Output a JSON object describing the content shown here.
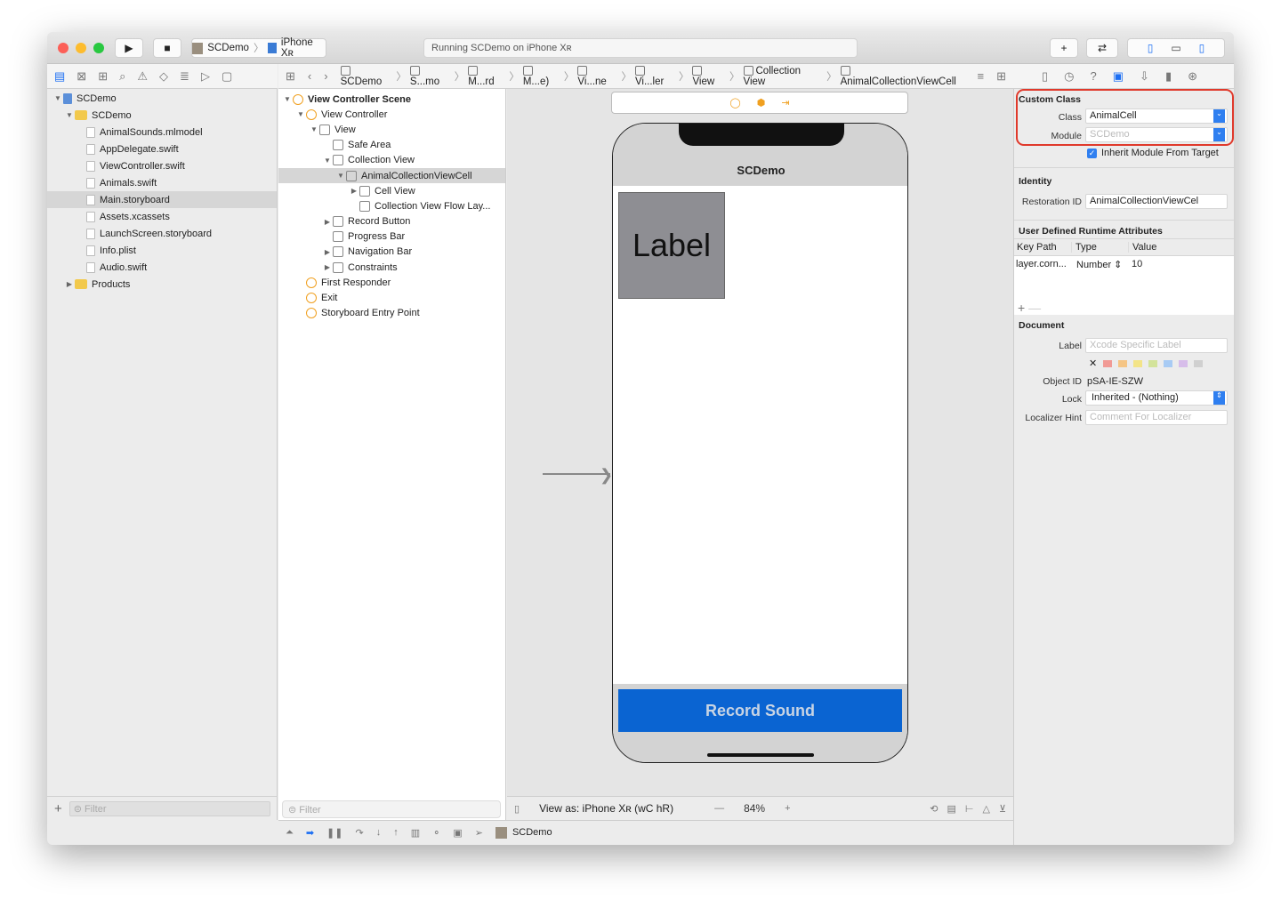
{
  "toolbar": {
    "scheme": "SCDemo",
    "device": "iPhone Xʀ",
    "status": "Running SCDemo on iPhone Xʀ"
  },
  "breadcrumb": [
    "SCDemo",
    "S...mo",
    "M...rd",
    "M...e)",
    "Vi...ne",
    "Vi...ler",
    "View",
    "Collection View",
    "AnimalCollectionViewCell"
  ],
  "navigator": {
    "items": [
      {
        "label": "SCDemo",
        "level": 0,
        "expanded": true,
        "icon": "project-icon"
      },
      {
        "label": "SCDemo",
        "level": 1,
        "expanded": true,
        "icon": "folder-icon"
      },
      {
        "label": "AnimalSounds.mlmodel",
        "level": 2,
        "icon": "mlmodel-icon"
      },
      {
        "label": "AppDelegate.swift",
        "level": 2,
        "icon": "swift-file-icon"
      },
      {
        "label": "ViewController.swift",
        "level": 2,
        "icon": "swift-file-icon"
      },
      {
        "label": "Animals.swift",
        "level": 2,
        "icon": "swift-file-icon"
      },
      {
        "label": "Main.storyboard",
        "level": 2,
        "icon": "storyboard-icon",
        "selected": true
      },
      {
        "label": "Assets.xcassets",
        "level": 2,
        "icon": "assets-icon"
      },
      {
        "label": "LaunchScreen.storyboard",
        "level": 2,
        "icon": "storyboard-icon"
      },
      {
        "label": "Info.plist",
        "level": 2,
        "icon": "plist-icon"
      },
      {
        "label": "Audio.swift",
        "level": 2,
        "icon": "swift-file-icon"
      },
      {
        "label": "Products",
        "level": 1,
        "expanded": false,
        "icon": "folder-icon"
      }
    ],
    "filter_placeholder": "Filter"
  },
  "outline": {
    "items": [
      {
        "label": "View Controller Scene",
        "level": 0,
        "tri": "open",
        "bold": true
      },
      {
        "label": "View Controller",
        "level": 1,
        "tri": "open"
      },
      {
        "label": "View",
        "level": 2,
        "tri": "open"
      },
      {
        "label": "Safe Area",
        "level": 3
      },
      {
        "label": "Collection View",
        "level": 3,
        "tri": "open"
      },
      {
        "label": "AnimalCollectionViewCell",
        "level": 4,
        "tri": "open",
        "selected": true
      },
      {
        "label": "Cell View",
        "level": 5,
        "tri": "closed"
      },
      {
        "label": "Collection View Flow Lay...",
        "level": 5
      },
      {
        "label": "Record Button",
        "level": 3,
        "tri": "closed"
      },
      {
        "label": "Progress Bar",
        "level": 3
      },
      {
        "label": "Navigation Bar",
        "level": 3,
        "tri": "closed"
      },
      {
        "label": "Constraints",
        "level": 3,
        "tri": "closed"
      },
      {
        "label": "First Responder",
        "level": 1
      },
      {
        "label": "Exit",
        "level": 1
      },
      {
        "label": "Storyboard Entry Point",
        "level": 1
      }
    ],
    "filter_placeholder": "Filter"
  },
  "canvas": {
    "nav_title": "SCDemo",
    "cell_label": "Label",
    "record_button": "Record Sound",
    "view_as": "View as: iPhone Xʀ (wC hR)",
    "zoom": "84%",
    "accent": "#0a64d2"
  },
  "debug": {
    "target": "SCDemo"
  },
  "inspector": {
    "custom_class": {
      "title": "Custom Class",
      "class_label": "Class",
      "class_value": "AnimalCell",
      "module_label": "Module",
      "module_placeholder": "SCDemo",
      "inherit": "Inherit Module From Target",
      "inherit_checked": true
    },
    "identity": {
      "title": "Identity",
      "restoration_label": "Restoration ID",
      "restoration_value": "AnimalCollectionViewCel"
    },
    "runtime": {
      "title": "User Defined Runtime Attributes",
      "headers": [
        "Key Path",
        "Type",
        "Value"
      ],
      "rows": [
        {
          "key": "layer.corn...",
          "type": "Number",
          "value": "10"
        }
      ]
    },
    "document": {
      "title": "Document",
      "label_label": "Label",
      "label_placeholder": "Xcode Specific Label",
      "object_id_label": "Object ID",
      "object_id": "pSA-IE-SZW",
      "lock_label": "Lock",
      "lock_value": "Inherited - (Nothing)",
      "hint_label": "Localizer Hint",
      "hint_placeholder": "Comment For Localizer"
    },
    "highlight": "#e0392b"
  }
}
